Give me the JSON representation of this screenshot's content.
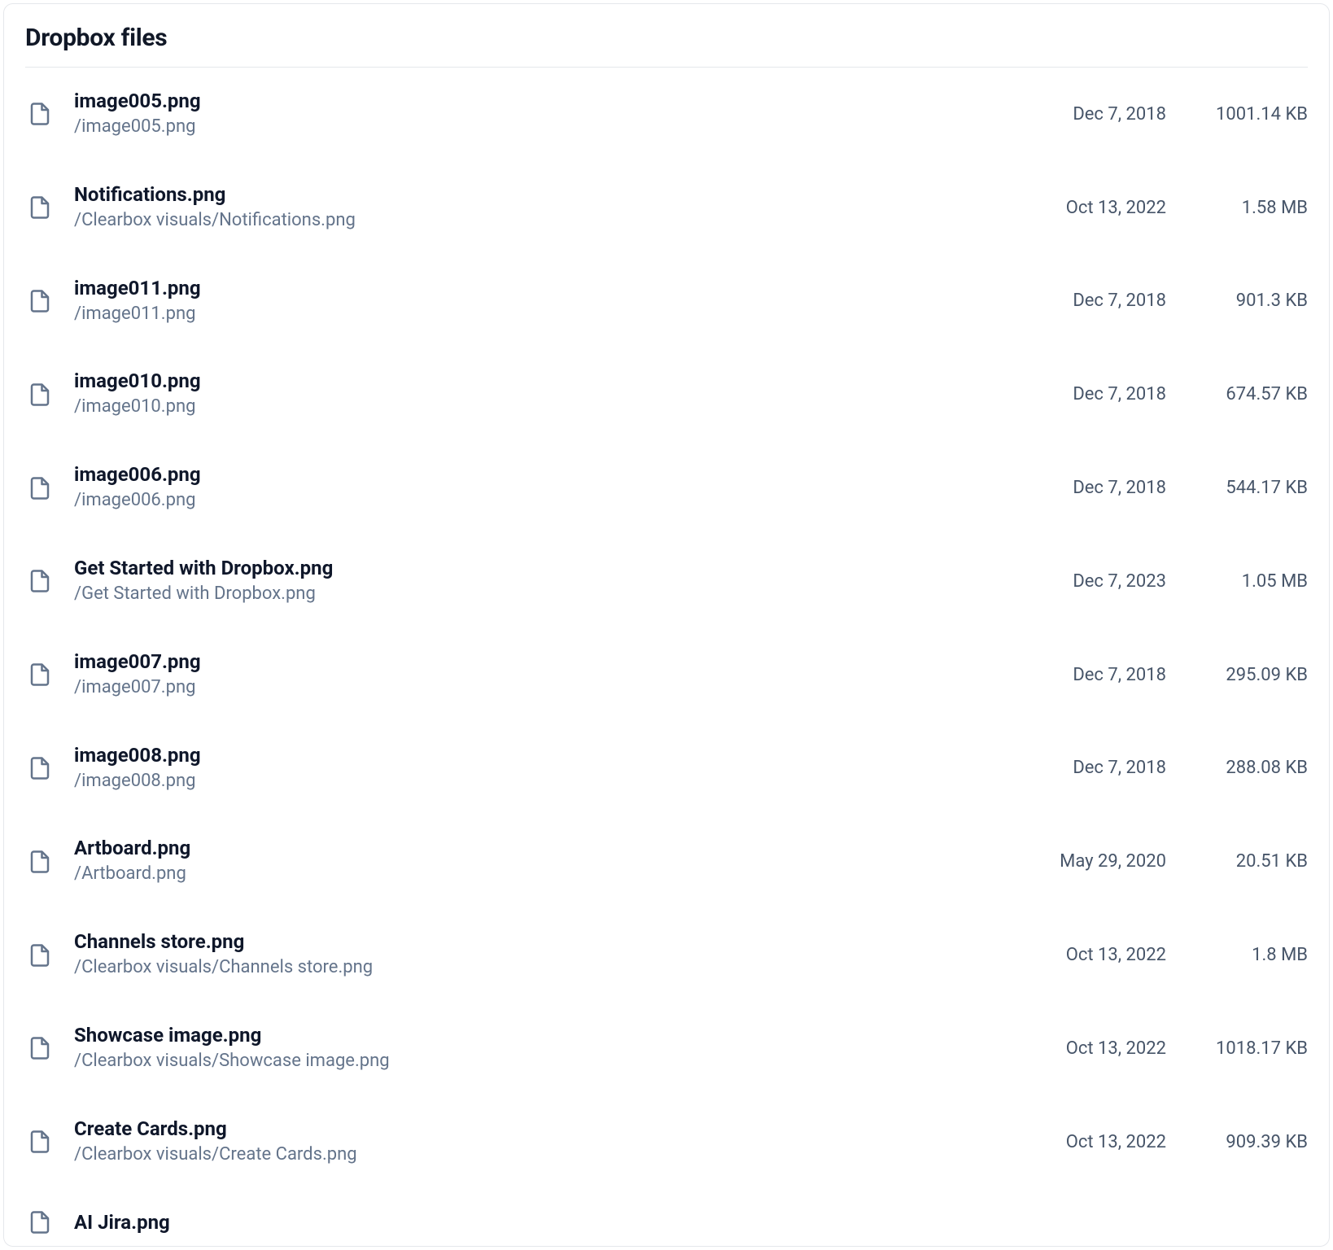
{
  "header": {
    "title": "Dropbox files"
  },
  "files": [
    {
      "name": "image005.png",
      "path": "/image005.png",
      "date": "Dec 7, 2018",
      "size": "1001.14 KB"
    },
    {
      "name": "Notifications.png",
      "path": "/Clearbox visuals/Notifications.png",
      "date": "Oct 13, 2022",
      "size": "1.58 MB"
    },
    {
      "name": "image011.png",
      "path": "/image011.png",
      "date": "Dec 7, 2018",
      "size": "901.3 KB"
    },
    {
      "name": "image010.png",
      "path": "/image010.png",
      "date": "Dec 7, 2018",
      "size": "674.57 KB"
    },
    {
      "name": "image006.png",
      "path": "/image006.png",
      "date": "Dec 7, 2018",
      "size": "544.17 KB"
    },
    {
      "name": "Get Started with Dropbox.png",
      "path": "/Get Started with Dropbox.png",
      "date": "Dec 7, 2023",
      "size": "1.05 MB"
    },
    {
      "name": "image007.png",
      "path": "/image007.png",
      "date": "Dec 7, 2018",
      "size": "295.09 KB"
    },
    {
      "name": "image008.png",
      "path": "/image008.png",
      "date": "Dec 7, 2018",
      "size": "288.08 KB"
    },
    {
      "name": "Artboard.png",
      "path": "/Artboard.png",
      "date": "May 29, 2020",
      "size": "20.51 KB"
    },
    {
      "name": "Channels store.png",
      "path": "/Clearbox visuals/Channels store.png",
      "date": "Oct 13, 2022",
      "size": "1.8 MB"
    },
    {
      "name": "Showcase image.png",
      "path": "/Clearbox visuals/Showcase image.png",
      "date": "Oct 13, 2022",
      "size": "1018.17 KB"
    },
    {
      "name": "Create Cards.png",
      "path": "/Clearbox visuals/Create Cards.png",
      "date": "Oct 13, 2022",
      "size": "909.39 KB"
    },
    {
      "name": "AI Jira.png",
      "path": "",
      "date": "",
      "size": ""
    }
  ]
}
